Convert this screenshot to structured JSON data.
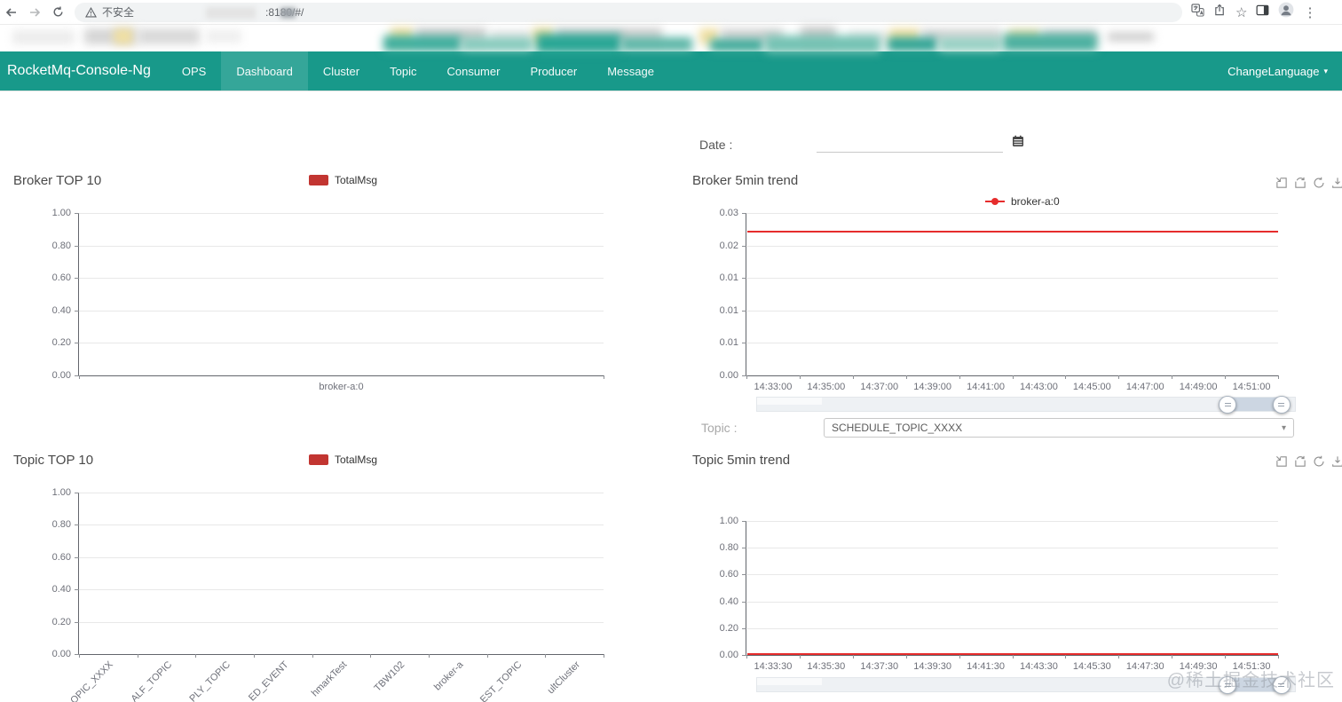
{
  "browser": {
    "security_label": "不安全",
    "url_suffix": ":8180/#/",
    "icons": [
      "back-icon",
      "forward-icon",
      "reload-icon",
      "warning-icon",
      "translate-icon",
      "share-icon",
      "star-icon",
      "side-panel-icon",
      "profile-icon",
      "menu-kebab-icon"
    ]
  },
  "navbar": {
    "brand": "RocketMq-Console-Ng",
    "items": [
      {
        "label": "OPS",
        "active": false
      },
      {
        "label": "Dashboard",
        "active": true
      },
      {
        "label": "Cluster",
        "active": false
      },
      {
        "label": "Topic",
        "active": false
      },
      {
        "label": "Consumer",
        "active": false
      },
      {
        "label": "Producer",
        "active": false
      },
      {
        "label": "Message",
        "active": false
      }
    ],
    "language_label": "ChangeLanguage"
  },
  "filters": {
    "date_label": "Date :",
    "date_value": "",
    "topic_label": "Topic :",
    "topic_selected": "SCHEDULE_TOPIC_XXXX"
  },
  "toolbox_icons": [
    "data-zoom-icon",
    "restore-zoom-icon",
    "refresh-icon",
    "download-icon"
  ],
  "watermark": "@稀土掘金技术社区",
  "colors": {
    "navbar_teal": "#18998a",
    "bar_red": "#c23531",
    "line_red": "#e62c2c"
  },
  "chart_data": [
    {
      "id": "broker_top10",
      "type": "bar",
      "title": "Broker TOP 10",
      "legend": [
        "TotalMsg"
      ],
      "y_tick_labels": [
        "1.00",
        "0.80",
        "0.60",
        "0.40",
        "0.20",
        "0.00"
      ],
      "ylim": [
        0,
        1
      ],
      "categories": [
        "broker-a:0"
      ],
      "values": [
        0
      ],
      "bars_visible": false,
      "grid": true
    },
    {
      "id": "broker_5min_trend",
      "type": "line",
      "title": "Broker 5min trend",
      "legend": [
        "broker-a:0"
      ],
      "y_tick_labels": [
        "0.03",
        "0.02",
        "0.01",
        "0.01",
        "0.01",
        "0.00"
      ],
      "ylim": [
        0,
        0.03
      ],
      "x": [
        "14:33:00",
        "14:35:00",
        "14:37:00",
        "14:39:00",
        "14:41:00",
        "14:43:00",
        "14:45:00",
        "14:47:00",
        "14:49:00",
        "14:51:00"
      ],
      "series": [
        {
          "name": "broker-a:0",
          "shape": "constant",
          "value_approx": 0.0266
        }
      ],
      "grid": true,
      "has_datazoom_slider": true
    },
    {
      "id": "topic_top10",
      "type": "bar",
      "title": "Topic TOP 10",
      "legend": [
        "TotalMsg"
      ],
      "y_tick_labels": [
        "1.00",
        "0.80",
        "0.60",
        "0.40",
        "0.20",
        "0.00"
      ],
      "ylim": [
        0,
        1
      ],
      "categories": [
        "OPIC_XXXX",
        "ALF_TOPIC",
        "PLY_TOPIC",
        "ED_EVENT",
        "hmarkTest",
        "TBW102",
        "broker-a",
        "EST_TOPIC",
        "ultCluster"
      ],
      "categories_truncated_by_viewport": true,
      "x_labels_rotated": true,
      "bars_visible": false,
      "grid": true
    },
    {
      "id": "topic_5min_trend",
      "type": "line",
      "title": "Topic 5min trend",
      "legend": [],
      "y_tick_labels": [
        "1.00",
        "0.80",
        "0.60",
        "0.40",
        "0.20",
        "0.00"
      ],
      "ylim": [
        0,
        1
      ],
      "x": [
        "14:33:30",
        "14:35:30",
        "14:37:30",
        "14:39:30",
        "14:41:30",
        "14:43:30",
        "14:45:30",
        "14:47:30",
        "14:49:30",
        "14:51:30"
      ],
      "series": [
        {
          "name": "",
          "shape": "constant",
          "value_approx": 0
        }
      ],
      "grid": true,
      "has_datazoom_slider": true
    }
  ]
}
